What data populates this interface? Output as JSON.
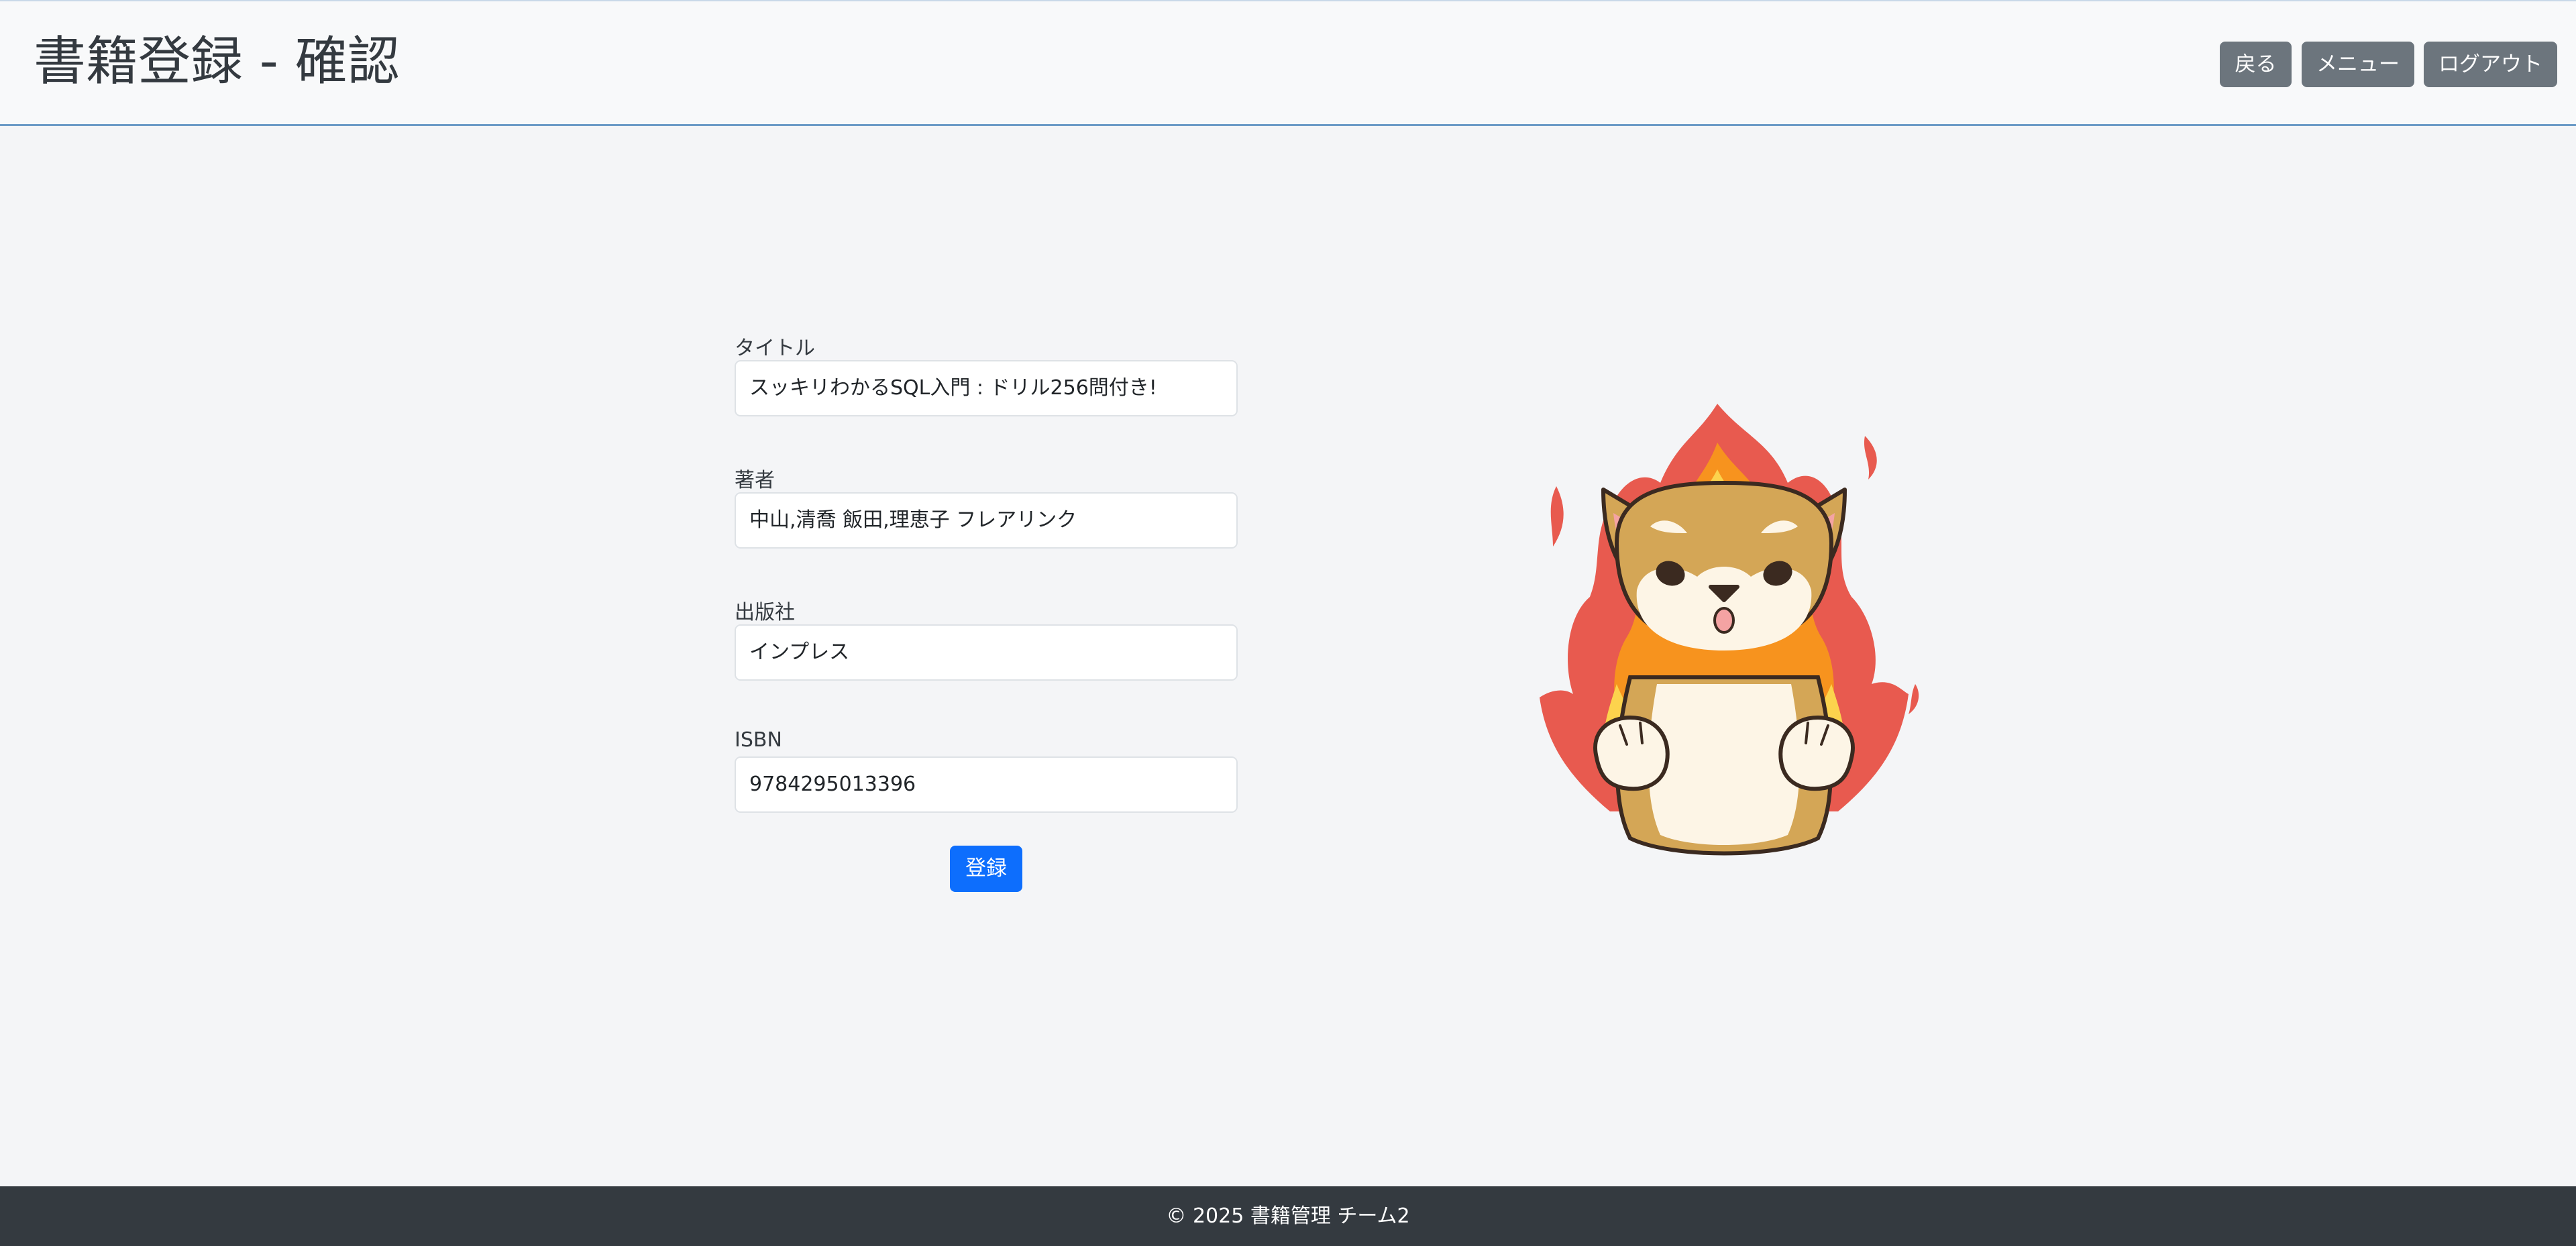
{
  "header": {
    "title": "書籍登録 - 確認",
    "buttons": {
      "back": "戻る",
      "menu": "メニュー",
      "logout": "ログアウト"
    }
  },
  "form": {
    "title": {
      "label": "タイトル",
      "value": "スッキリわかるSQL入門 : ドリル256問付き!"
    },
    "author": {
      "label": "著者",
      "value": "中山,清喬 飯田,理恵子 フレアリンク"
    },
    "publisher": {
      "label": "出版社",
      "value": "インプレス"
    },
    "isbn": {
      "label": "ISBN",
      "value": "9784295013396"
    },
    "submit_label": "登録"
  },
  "illustration": {
    "icon": "angry-shiba-dog-with-flames-icon"
  },
  "footer": {
    "text": "© 2025 書籍管理 チーム2"
  },
  "colors": {
    "header_bg": "#f8f9fa",
    "header_border": "#6c9bc7",
    "secondary_button": "#6c757d",
    "primary_button": "#0d6efd",
    "footer_bg": "#343a40",
    "page_bg": "#f4f5f7"
  }
}
